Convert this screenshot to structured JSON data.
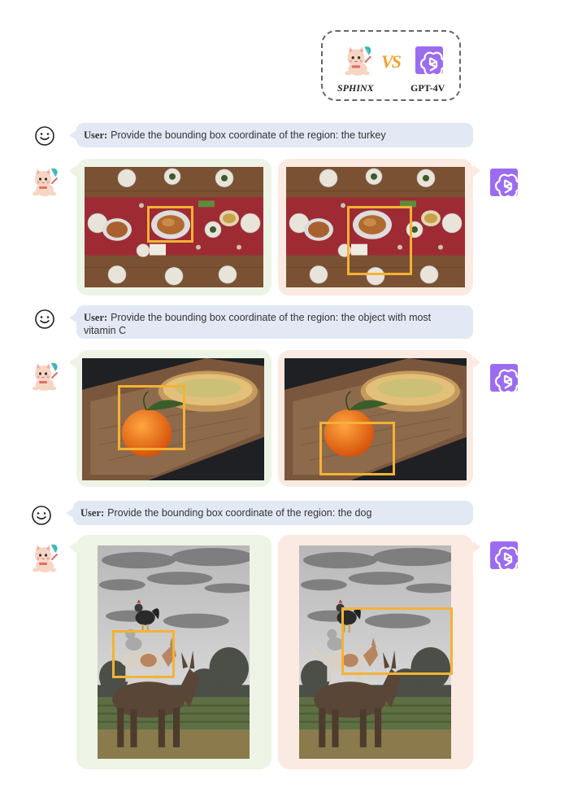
{
  "legend": {
    "model_a": "SPHINX",
    "vs": "VS",
    "model_b": "GPT-4V"
  },
  "colors": {
    "bbox": "#f4b235",
    "sphinx_panel": "#edf4e5",
    "gpt_panel": "#fbeae1",
    "bubble": "#e3e9f4",
    "gpt_icon": "#9c6cf0"
  },
  "examples": [
    {
      "speaker": "User:",
      "prompt": "Provide the bounding box coordinate of the region: the turkey",
      "sphinx_image": "table-feast-photo",
      "gpt_image": "table-feast-photo"
    },
    {
      "speaker": "User:",
      "prompt": "Provide the bounding box coordinate of the region: the object with most vitamin C",
      "sphinx_image": "orange-and-bread-photo",
      "gpt_image": "orange-and-bread-photo"
    },
    {
      "speaker": "User:",
      "prompt": "Provide the bounding box coordinate of the region: the dog",
      "sphinx_image": "stacked-animals-photo",
      "gpt_image": "stacked-animals-photo"
    }
  ]
}
